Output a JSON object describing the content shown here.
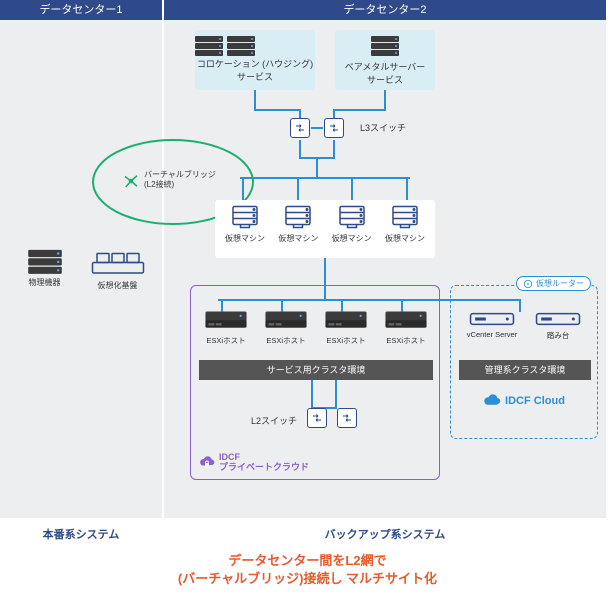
{
  "dc1": {
    "header": "データセンター1",
    "footer": "本番系システム"
  },
  "dc2": {
    "header": "データセンター2",
    "footer": "バックアップ系システム"
  },
  "caption_line1": "データセンター間をL2網で",
  "caption_line2": "(バーチャルブリッジ)接続し マルチサイト化",
  "colo": {
    "label_l1": "コロケーション (ハウジング)",
    "label_l2": "サービス"
  },
  "bare": {
    "label_l1": "ベアメタルサーバー",
    "label_l2": "サービス"
  },
  "l3_label": "L3スイッチ",
  "vms": [
    "仮想マシン",
    "仮想マシン",
    "仮想マシン",
    "仮想マシン"
  ],
  "esxi": [
    "ESXiホスト",
    "ESXiホスト",
    "ESXiホスト",
    "ESXiホスト"
  ],
  "svc_bar": "サービス用クラスタ環境",
  "l2_label": "L2スイッチ",
  "pc_title_l1": "IDCF",
  "pc_title_l2": "プライベートクラウド",
  "vr_badge": "仮想ルーター",
  "mgmt": {
    "vcenter": "vCenter Server",
    "fumidai": "踏み台"
  },
  "mgmt_bar": "管理系クラスタ環境",
  "idcf_cloud": "IDCF Cloud",
  "dc1_items": {
    "phys": "物理機器",
    "virt": "仮想化基盤"
  },
  "vbridge_l1": "バーチャルブリッジ",
  "vbridge_l2": "(L2接続)"
}
